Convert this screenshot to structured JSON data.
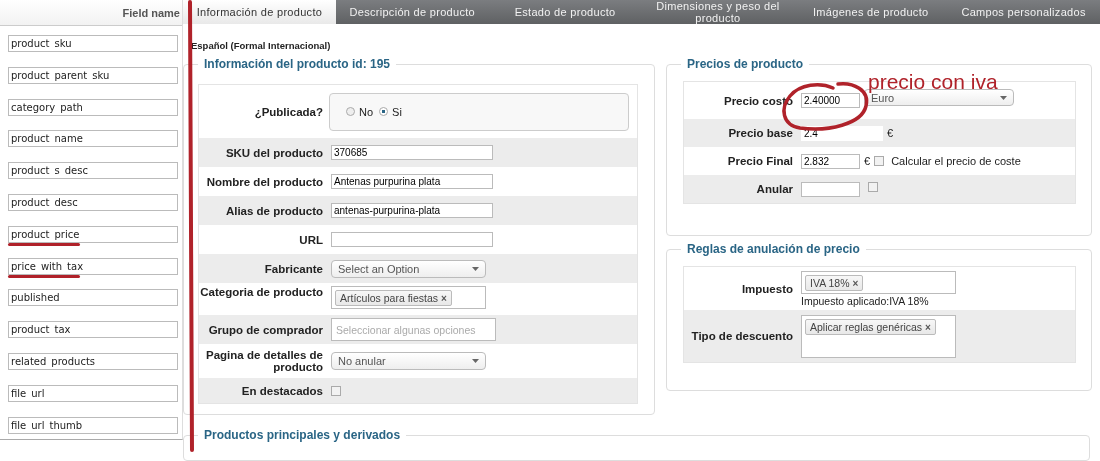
{
  "field_list": {
    "header": "Field name",
    "fields": [
      {
        "name": "product_sku",
        "underlined": false
      },
      {
        "name": "product_parent_sku",
        "underlined": false
      },
      {
        "name": "category_path",
        "underlined": false
      },
      {
        "name": "product_name",
        "underlined": false
      },
      {
        "name": "product_s_desc",
        "underlined": false
      },
      {
        "name": "product_desc",
        "underlined": false
      },
      {
        "name": "product_price",
        "underlined": true
      },
      {
        "name": "price_with_tax",
        "underlined": true
      },
      {
        "name": "published",
        "underlined": false
      },
      {
        "name": "product_tax",
        "underlined": false
      },
      {
        "name": "related_products",
        "underlined": false
      },
      {
        "name": "file_url",
        "underlined": false
      },
      {
        "name": "file_url_thumb",
        "underlined": false
      }
    ]
  },
  "tabs": [
    {
      "label": "Información de producto",
      "selected": true
    },
    {
      "label": "Descripción de producto",
      "selected": false
    },
    {
      "label": "Estado de producto",
      "selected": false
    },
    {
      "label": "Dimensiones y peso del producto",
      "selected": false
    },
    {
      "label": "Imágenes de producto",
      "selected": false
    },
    {
      "label": "Campos personalizados",
      "selected": false
    }
  ],
  "language": "Español (Formal Internacional)",
  "product_info": {
    "legend": "Información del producto id: 195",
    "rows": [
      {
        "kind": "radio",
        "label": "¿Publicada?",
        "options": [
          {
            "label": "No",
            "selected": false
          },
          {
            "label": "Si",
            "selected": true
          }
        ]
      },
      {
        "kind": "text",
        "label": "SKU del producto",
        "value": "370685"
      },
      {
        "kind": "text",
        "label": "Nombre del producto",
        "value": "Antenas purpurina plata"
      },
      {
        "kind": "text",
        "label": "Alias de producto",
        "value": "antenas-purpurina-plata"
      },
      {
        "kind": "text",
        "label": "URL",
        "value": ""
      },
      {
        "kind": "select",
        "label": "Fabricante",
        "value": "Select an Option"
      },
      {
        "kind": "tags",
        "label": "Categoria de producto",
        "tags": [
          {
            "label": "Artículos para fiestas",
            "remove": "×"
          }
        ]
      },
      {
        "kind": "placeholder",
        "label": "Grupo de comprador",
        "placeholder": "Seleccionar algunas opciones"
      },
      {
        "kind": "select",
        "label": "Pagina de detalles de producto",
        "value": "No anular"
      },
      {
        "kind": "checkbox",
        "label": "En destacados",
        "checked": false
      }
    ]
  },
  "prices": {
    "legend": "Precios de producto",
    "cost": {
      "label": "Precio costo",
      "value": "2.40000",
      "currency": "Euro"
    },
    "base": {
      "label": "Precio base",
      "value": "2.4",
      "currency": "€"
    },
    "final": {
      "label": "Precio Final",
      "value": "2.832",
      "currency": "€",
      "checked": false,
      "check_label": "Calcular el precio de coste"
    },
    "override": {
      "label": "Anular",
      "checked": false
    }
  },
  "price_rules": {
    "legend": "Reglas de anulación de precio",
    "tax": {
      "label": "Impuesto",
      "tags": [
        {
          "label": "IVA 18%",
          "remove": "×"
        }
      ],
      "note": "Impuesto aplicado:IVA 18%"
    },
    "discount": {
      "label": "Tipo de descuento",
      "tags": [
        {
          "label": "Aplicar reglas genéricas",
          "remove": "×"
        }
      ]
    }
  },
  "related_legend": "Productos principales y derivados",
  "annotation": {
    "note": "precio con iva"
  }
}
